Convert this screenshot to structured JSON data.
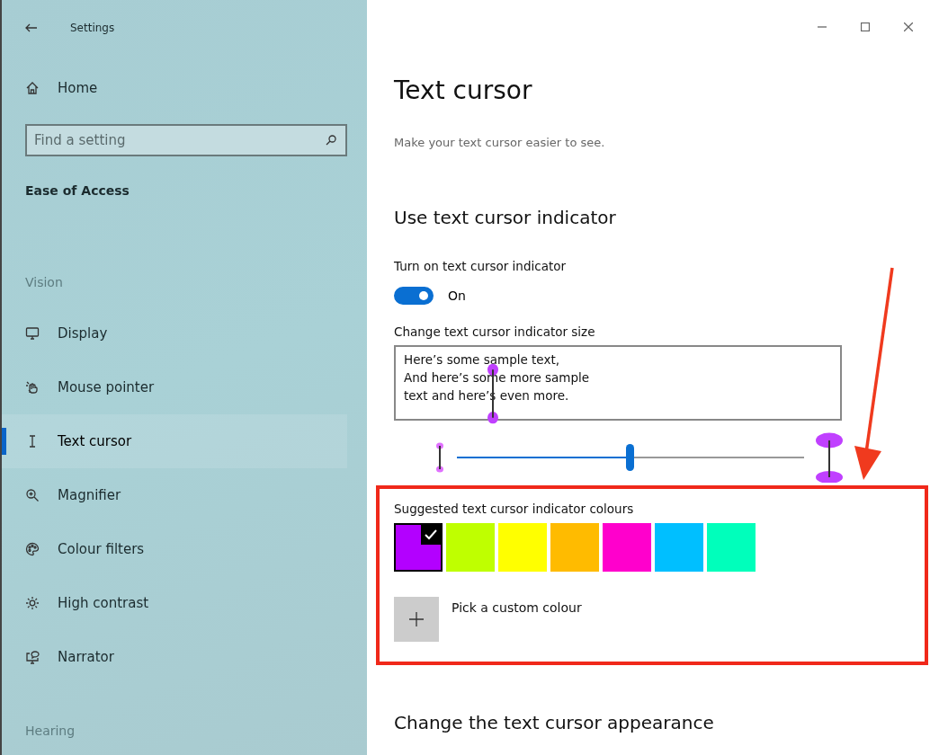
{
  "window": {
    "title": "Settings"
  },
  "sidebar": {
    "home": "Home",
    "search": {
      "placeholder": "Find a setting"
    },
    "section": "Ease of Access",
    "groups": [
      {
        "heading": "Vision",
        "items": [
          {
            "label": "Display",
            "selected": false
          },
          {
            "label": "Mouse pointer",
            "selected": false
          },
          {
            "label": "Text cursor",
            "selected": true
          },
          {
            "label": "Magnifier",
            "selected": false
          },
          {
            "label": "Colour filters",
            "selected": false
          },
          {
            "label": "High contrast",
            "selected": false
          },
          {
            "label": "Narrator",
            "selected": false
          }
        ]
      },
      {
        "heading": "Hearing"
      }
    ]
  },
  "page": {
    "title": "Text cursor",
    "subtitle": "Make your text cursor easier to see.",
    "section": "Use text cursor indicator",
    "toggle": {
      "label": "Turn on text cursor indicator",
      "on": true,
      "state_text": "On"
    },
    "size": {
      "label": "Change text cursor indicator size",
      "sample_lines": [
        "Here’s some sample text,",
        "And here’s some more sample",
        "text and here’s even more."
      ],
      "level": 0.5
    },
    "colours": {
      "label": "Suggested text cursor indicator colours",
      "swatches": [
        {
          "color": "#b300ff",
          "selected": true
        },
        {
          "color": "#bfff00",
          "selected": false
        },
        {
          "color": "#ffff00",
          "selected": false
        },
        {
          "color": "#ffbb00",
          "selected": false
        },
        {
          "color": "#ff00cc",
          "selected": false
        },
        {
          "color": "#00bfff",
          "selected": false
        },
        {
          "color": "#00ffbb",
          "selected": false
        }
      ],
      "custom": "Pick a custom colour"
    },
    "next_section": "Change the text cursor appearance"
  }
}
